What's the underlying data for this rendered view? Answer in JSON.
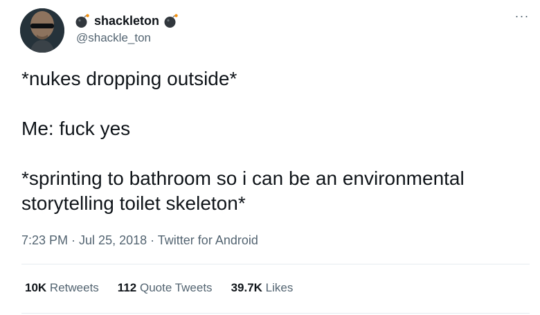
{
  "tweet": {
    "display_name": "shackleton",
    "handle": "@shackle_ton",
    "more_label": "···",
    "lines": [
      "*nukes dropping outside*",
      "Me: fuck yes",
      "*sprinting to bathroom so i can be an environmental storytelling toilet skeleton*"
    ],
    "meta": {
      "time": "7:23 PM",
      "sep1": " · ",
      "date": "Jul 25, 2018",
      "sep2": " · ",
      "source": "Twitter for Android"
    },
    "stats": {
      "retweets_count": "10K",
      "retweets_label": "Retweets",
      "quotes_count": "112",
      "quotes_label": "Quote Tweets",
      "likes_count": "39.7K",
      "likes_label": "Likes"
    }
  },
  "icons": {
    "avatar": "avatar-image",
    "name_emoji": "bomb-icon",
    "more": "more-options-icon"
  },
  "colors": {
    "text_primary": "#0f1419",
    "text_secondary": "#536471",
    "divider": "#e6ecf0",
    "bomb_fuse": "#f4900c"
  }
}
